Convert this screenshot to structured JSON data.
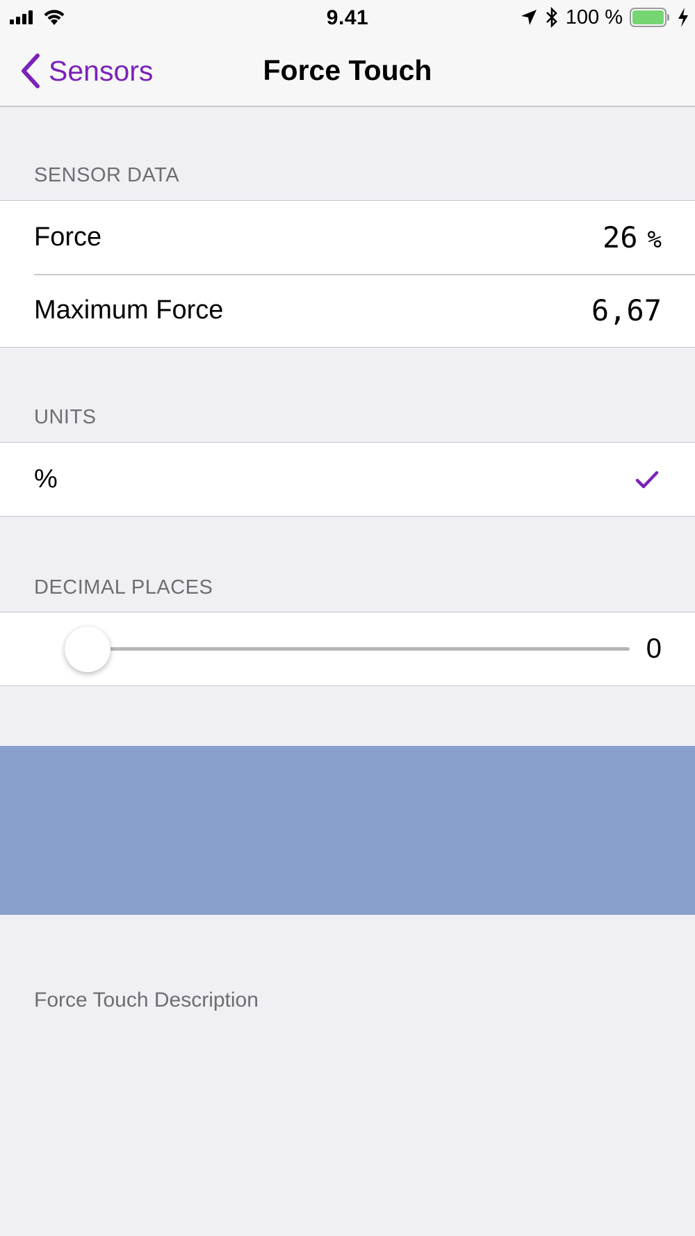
{
  "status_bar": {
    "time": "9.41",
    "battery_percent": "100 %",
    "battery_level": 1.0,
    "icons": [
      "signal-icon",
      "wifi-icon",
      "location-icon",
      "bluetooth-icon",
      "battery-icon",
      "charging-bolt-icon"
    ]
  },
  "nav": {
    "back_label": "Sensors",
    "title": "Force Touch"
  },
  "sections": {
    "sensor_data": {
      "header": "SENSOR DATA",
      "rows": [
        {
          "label": "Force",
          "value": "26",
          "unit": "%"
        },
        {
          "label": "Maximum Force",
          "value": "6,67"
        }
      ]
    },
    "units": {
      "header": "UNITS",
      "option": "%",
      "selected": true
    },
    "decimal_places": {
      "header": "DECIMAL PLACES",
      "value": "0",
      "slider_fraction": 0
    }
  },
  "description": "Force Touch Description",
  "colors": {
    "accent": "#7b22b8",
    "background": "#efeff4",
    "force_area": "#89a0cc",
    "battery_fill": "#76d672"
  }
}
